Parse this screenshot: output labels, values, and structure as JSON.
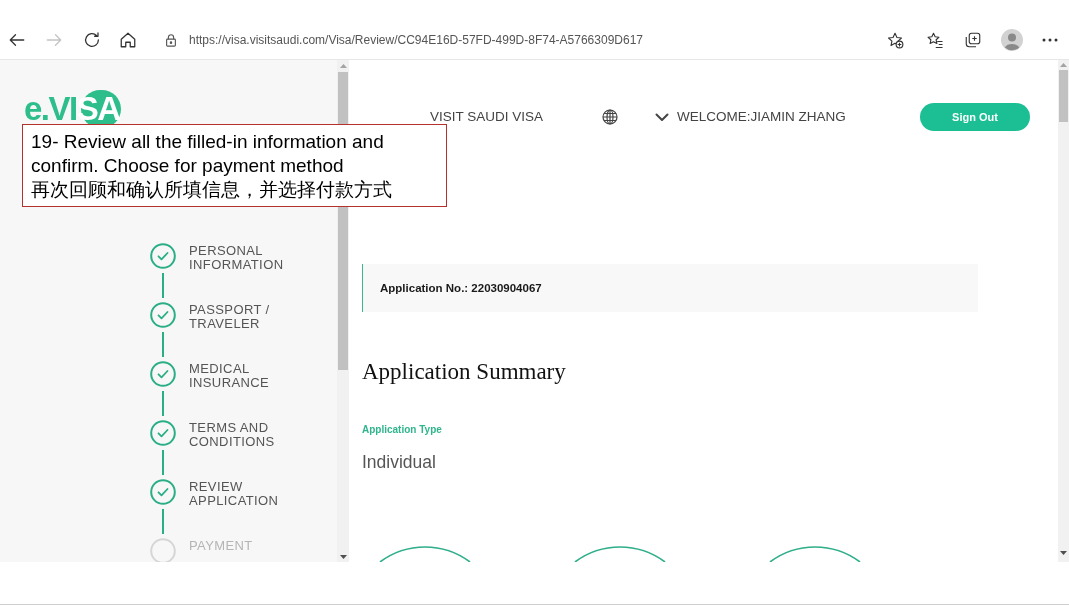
{
  "browser": {
    "url": "https://visa.visitsaudi.com/Visa/Review/CC94E16D-57FD-499D-8F74-A5766309D617",
    "back": {
      "disabled": false
    },
    "forward": {
      "disabled": true
    }
  },
  "sidebar": {
    "logo": "e.VI**SA**",
    "steps": [
      {
        "label": "PERSONAL\nINFORMATION",
        "completed": true
      },
      {
        "label": "PASSPORT /\nTRAVELER",
        "completed": true
      },
      {
        "label": "MEDICAL\nINSURANCE",
        "completed": true
      },
      {
        "label": "TERMS AND\nCONDITIONS",
        "completed": true
      },
      {
        "label": "REVIEW\nAPPLICATION",
        "completed": true
      },
      {
        "label": "PAYMENT",
        "completed": false
      }
    ]
  },
  "header": {
    "nav_link": "VISIT SAUDI VISA",
    "welcome": "WELCOME:JIAMIN ZHANG",
    "sign_out": "Sign Out"
  },
  "annotation": {
    "text": "19- Review all the filled-in information and\nconfirm. Choose for payment method\n再次回顾和确认所填信息，并选择付款方式"
  },
  "application": {
    "number": "Application No.: 22030904067",
    "summary_title": "Application Summary",
    "type_label": "Application Type",
    "type_value": "Individual"
  }
}
